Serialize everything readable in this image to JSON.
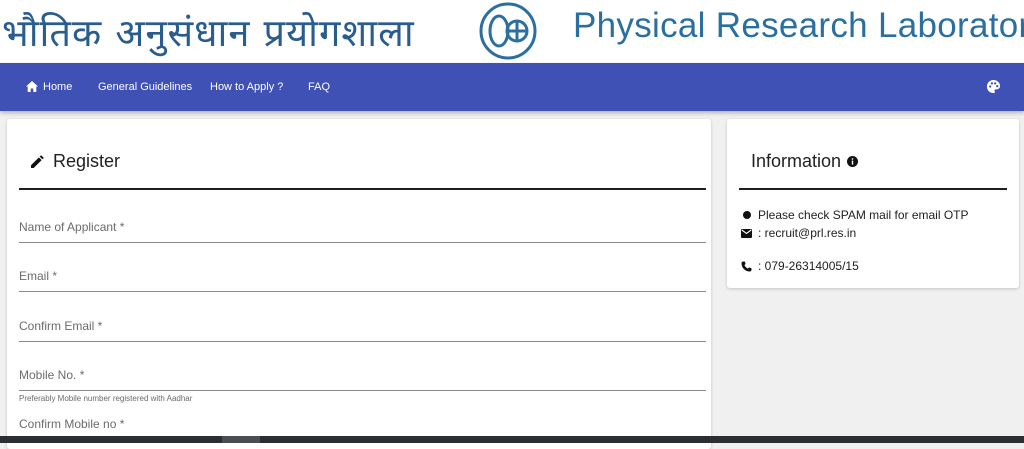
{
  "header": {
    "hindi_title": "भौतिक अनुसंधान प्रयोगशाला",
    "english_title": "Physical Research Laboratory",
    "logo_icon": "prl-logo-icon"
  },
  "navbar": {
    "background": "#3f51b5",
    "home": "Home",
    "guidelines": "General Guidelines",
    "apply": "How to Apply ?",
    "faq": "FAQ",
    "theme_icon": "palette-icon"
  },
  "register": {
    "title": "Register",
    "icon": "pencil-icon",
    "fields": [
      {
        "label": "Name of Applicant *",
        "value": ""
      },
      {
        "label": "Email *",
        "value": ""
      },
      {
        "label": "Confirm Email *",
        "value": ""
      },
      {
        "label": "Mobile No. *",
        "value": "",
        "hint": "Preferably Mobile number registered with Aadhar"
      },
      {
        "label": "Confirm Mobile no *",
        "value": ""
      }
    ]
  },
  "info": {
    "title": "Information",
    "icon": "info-icon",
    "items": [
      {
        "icon": "bullet-icon",
        "text": "Please check SPAM mail for email OTP"
      },
      {
        "icon": "email-icon",
        "text": ": recruit@prl.res.in"
      },
      {
        "icon": "phone-icon",
        "text": ": 079-26314005/15"
      }
    ]
  }
}
